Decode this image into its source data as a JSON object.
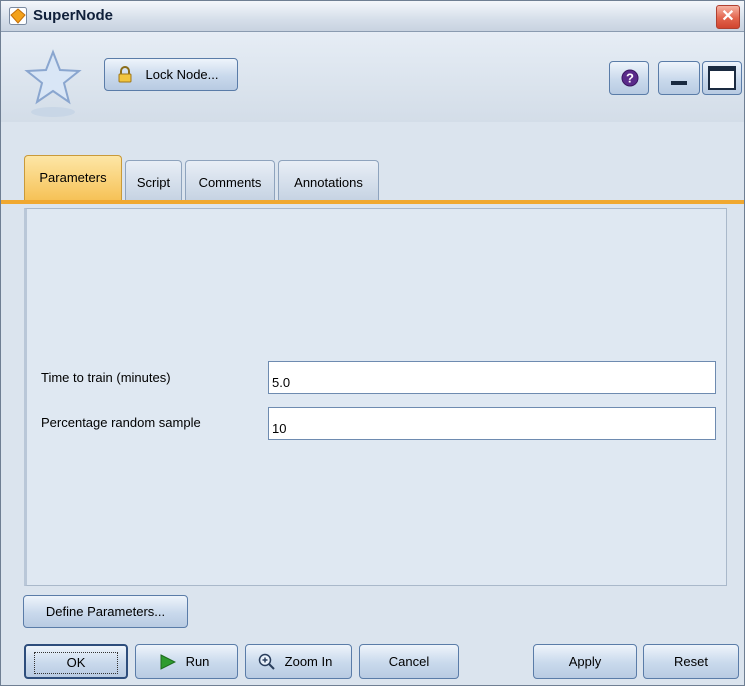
{
  "window": {
    "title": "SuperNode",
    "close_glyph": "✕"
  },
  "toolbar": {
    "lock_label": "Lock Node...",
    "help_glyph": "?"
  },
  "tabs": [
    {
      "label": "Parameters",
      "active": true
    },
    {
      "label": "Script",
      "active": false
    },
    {
      "label": "Comments",
      "active": false
    },
    {
      "label": "Annotations",
      "active": false
    }
  ],
  "parameters": {
    "time_label": "Time to train (minutes)",
    "time_value": "5.0",
    "sample_label": "Percentage random sample",
    "sample_value": "10"
  },
  "buttons": {
    "define": "Define Parameters...",
    "ok": "OK",
    "run": "Run",
    "zoom": "Zoom In",
    "cancel": "Cancel",
    "apply": "Apply",
    "reset": "Reset"
  },
  "colors": {
    "active_tab": "#f6c257",
    "tab_underline": "#f0a830",
    "panel": "#dfe8f2",
    "run_icon": "#2e9b2e"
  },
  "icons": [
    "supernode-icon",
    "star-icon",
    "lock-icon",
    "help-icon",
    "minimize-icon",
    "maximize-icon",
    "run-icon",
    "zoom-icon",
    "close-icon"
  ]
}
